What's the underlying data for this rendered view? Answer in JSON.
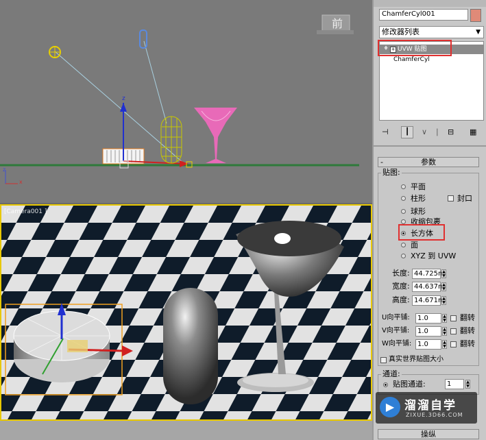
{
  "front_viewport": {
    "view_label": "前",
    "axis_z": "z",
    "axis_x": "x"
  },
  "persp_viewport": {
    "view_label": "[Camera001 ]"
  },
  "command_panel": {
    "object_name": "ChamferCyl001",
    "object_color": "#e08a78",
    "modifier_list_label": "修改器列表",
    "stack": [
      {
        "label": "UVW 贴图",
        "selected": true
      },
      {
        "label": "ChamferCyl",
        "selected": false
      }
    ],
    "rollout_title": "参数",
    "mapping_group_label": "贴图:",
    "mapping_options": [
      {
        "label": "平面",
        "selected": false
      },
      {
        "label": "柱形",
        "selected": false
      },
      {
        "label": "球形",
        "selected": false
      },
      {
        "label": "收缩包裹",
        "selected": false
      },
      {
        "label": "长方体",
        "selected": true
      },
      {
        "label": "面",
        "selected": false
      },
      {
        "label": "XYZ 到 UVW",
        "selected": false
      }
    ],
    "cap_label": "封口",
    "dimensions": [
      {
        "label": "长度:",
        "value": "44.725m"
      },
      {
        "label": "宽度:",
        "value": "44.637m"
      },
      {
        "label": "高度:",
        "value": "14.671m"
      }
    ],
    "tiles": [
      {
        "label": "U向平铺:",
        "value": "1.0",
        "flip_label": "翻转"
      },
      {
        "label": "V向平铺:",
        "value": "1.0",
        "flip_label": "翻转"
      },
      {
        "label": "W向平铺:",
        "value": "1.0",
        "flip_label": "翻转"
      }
    ],
    "real_world_label": "真实世界贴图大小",
    "channel_group_label": "通道:",
    "map_channel_label": "贴图通道:",
    "map_channel_value": "1",
    "manip_label": "操纵"
  },
  "watermark": {
    "brand": "溜溜自学",
    "url": "ZIXUE.3D66.COM"
  },
  "colors": {
    "highlight": "#e03030",
    "active_viewport_border": "#e8c800",
    "wineglass_front": "#e86ab8"
  }
}
